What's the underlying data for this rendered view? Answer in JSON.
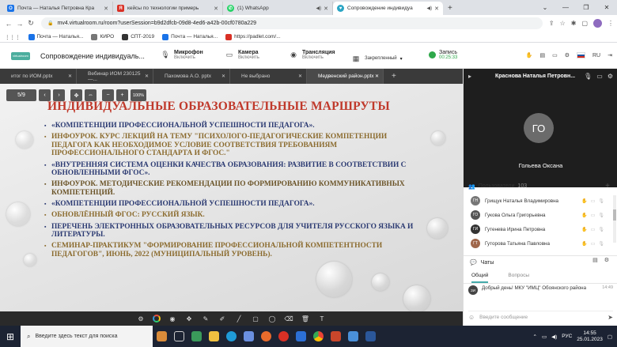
{
  "browser": {
    "tabs": [
      {
        "label": "Почта — Наталья Петровна Кра",
        "color": "#1a73e8",
        "icon": "mail-icon",
        "active": false
      },
      {
        "label": "кейсы по технологии примерь",
        "color": "#d93025",
        "icon": "yandex-icon",
        "active": false
      },
      {
        "label": "(1) WhatsApp",
        "color": "#25d366",
        "icon": "whatsapp-icon",
        "active": false
      },
      {
        "label": "Сопровождение индивидуа",
        "color": "#2aa5c4",
        "icon": "virtualroom-icon",
        "active": true
      }
    ],
    "url": "mv4.virtualroom.ru/room?userSession=b9d2dfcb-09d8-4ed6-a42b-00cf0780a229",
    "bookmarks": [
      {
        "label": "Почта — Наталья...",
        "color": "#1a73e8"
      },
      {
        "label": "КИРО",
        "color": "#777"
      },
      {
        "label": "СПТ-2019",
        "color": "#333"
      },
      {
        "label": "Почта — Наталья...",
        "color": "#1a73e8"
      },
      {
        "label": "https://padlet.com/...",
        "color": "#d93025"
      }
    ]
  },
  "app": {
    "title": "Сопровождение индивидуаль...",
    "logo_text": "virtualroom",
    "mic": {
      "label": "Микрофон",
      "sub": "Включить"
    },
    "camera": {
      "label": "Камера",
      "sub": "Включить"
    },
    "stream": {
      "label": "Трансляция",
      "sub": "Включить"
    },
    "pinned": "Закрепленный",
    "record": {
      "label": "Запись",
      "time": "00:25:33"
    },
    "lang": "RU"
  },
  "presentation": {
    "tabs": [
      "итог по ИОМ.pptx",
      "Вебинар ИОМ 230125 —...",
      "Пахомова А.О. pptx",
      "Не выбрано",
      "Медвенский район.pptx"
    ],
    "page": "5/9",
    "zoom": "100%",
    "slide_title": "ИНДИВИДУАЛЬНЫЕ ОБРАЗОВАТЕЛЬНЫЕ МАРШРУТЫ",
    "items": [
      {
        "text": "«КОМПЕТЕНЦИИ ПРОФЕССИОНАЛЬНОЙ УСПЕШНОСТИ ПЕДАГОГА».",
        "style": "c1"
      },
      {
        "text": "ИНФОУРОК. КУРС ЛЕКЦИЙ НА ТЕМУ \"ПСИХОЛОГО-ПЕДАГОГИЧЕСКИЕ КОМПЕТЕНЦИИ ПЕДАГОГА КАК НЕОБХОДИМОЕ УСЛОВИЕ СООТВЕТСТВИЯ ТРЕБОВАНИЯМ ПРОФЕССИОНАЛЬНОГО СТАНДАРТА И ФГОС.\"",
        "style": "c2"
      },
      {
        "text": "«ВНУТРЕННЯЯ СИСТЕМА ОЦЕНКИ КАЧЕСТВА ОБРАЗОВАНИЯ: РАЗВИТИЕ В СООТВЕТСТВИИ С ОБНОВЛЕННЫМИ ФГОС».",
        "style": "c1"
      },
      {
        "text": "ИНФОУРОК. МЕТОДИЧЕСКИЕ РЕКОМЕНДАЦИИ ПО ФОРМИРОВАНИЮ КОММУНИКАТИВНЫХ КОМПЕТЕНЦИЙ.",
        "style": "c3"
      },
      {
        "text": "«КОМПЕТЕНЦИИ ПРОФЕССИОНАЛЬНОЙ УСПЕШНОСТИ ПЕДАГОГА».",
        "style": "c1"
      },
      {
        "text": "ОБНОВЛЁННЫЙ ФГОС: РУССКИЙ ЯЗЫК.",
        "style": "c2"
      },
      {
        "text": "ПЕРЕЧЕНЬ ЭЛЕКТРОННЫХ ОБРАЗОВАТЕЛЬНЫХ РЕСУРСОВ ДЛЯ УЧИТЕЛЯ РУССКОГО ЯЗЫКА И ЛИТЕРАТУРЫ.",
        "style": "c1"
      },
      {
        "text": "СЕМИНАР-ПРАКТИКУМ \"ФОРМИРОВАНИЕ ПРОФЕССИОНАЛЬНОЙ КОМПЕТЕНТНОСТИ ПЕДАГОГОВ\", ИЮНЬ, 2022 (МУНИЦИПАЛЬНЫЙ УРОВЕНЬ).",
        "style": "c2"
      }
    ]
  },
  "panel": {
    "speaker_name": "Краснова Наталья Петровн...",
    "avatar_initials": "ГО",
    "video_caption": "Гольева Оксана",
    "users_label": "Пользователи",
    "users_count": "103",
    "users": [
      {
        "initials": "ГН",
        "name": "Грищук Наталья Владимировна",
        "color": "#666"
      },
      {
        "initials": "ГО",
        "name": "Гукова Ольга Григорьевна",
        "color": "#555"
      },
      {
        "initials": "ГИ",
        "name": "Гутенева Ирина Петровна",
        "color": "#333"
      },
      {
        "initials": "ГТ",
        "name": "Гуторова Татьяна Павловна",
        "color": "#a0674b"
      }
    ],
    "chats_label": "Чаты",
    "chat_tabs": [
      "Общий",
      "Вопросы"
    ],
    "message": {
      "initials": "ЗИ",
      "text": "Добрый день! МКУ \"ИМЦ\" Обоянского района",
      "time": "14:49"
    },
    "input_placeholder": "Введите сообщение"
  },
  "taskbar": {
    "search_placeholder": "Введите здесь текст для поиска",
    "lang": "РУС",
    "time": "14:55",
    "date": "25.01.2023"
  }
}
